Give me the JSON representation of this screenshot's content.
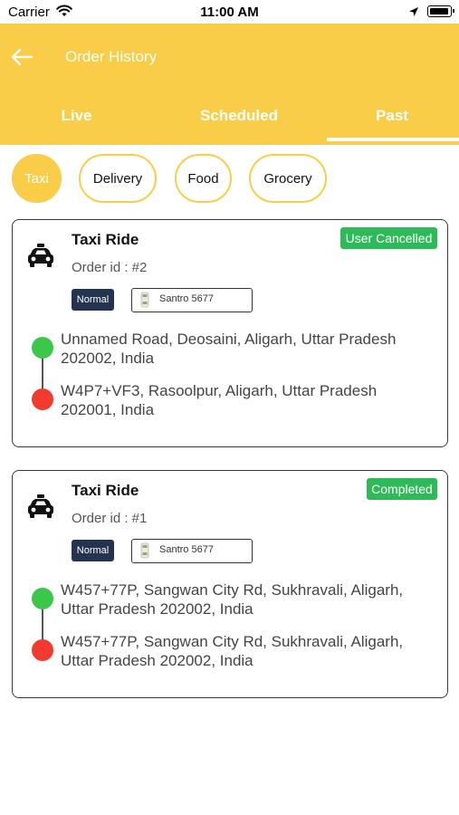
{
  "status_bar": {
    "carrier": "Carrier",
    "time": "11:00 AM"
  },
  "header": {
    "title": "Order History",
    "tabs": [
      {
        "label": "Live"
      },
      {
        "label": "Scheduled"
      },
      {
        "label": "Past",
        "active": true
      }
    ]
  },
  "filters": [
    {
      "label": "Taxi",
      "active": true
    },
    {
      "label": "Delivery"
    },
    {
      "label": "Food"
    },
    {
      "label": "Grocery"
    }
  ],
  "orders": [
    {
      "title": "Taxi Ride",
      "order_id": "Order id : #2",
      "status": "User Cancelled",
      "type_tag": "Normal",
      "vehicle": "Santro 5677",
      "pickup": "Unnamed Road, Deosaini, Aligarh, Uttar Pradesh 202002, India",
      "drop": "W4P7+VF3, Rasoolpur, Aligarh, Uttar Pradesh 202001, India"
    },
    {
      "title": "Taxi Ride",
      "order_id": "Order id : #1",
      "status": "Completed",
      "type_tag": "Normal",
      "vehicle": "Santro 5677",
      "pickup": "W457+77P, Sangwan City Rd, Sukhravali, Aligarh, Uttar Pradesh 202002, India",
      "drop": "W457+77P, Sangwan City Rd, Sukhravali, Aligarh, Uttar Pradesh 202002, India"
    }
  ],
  "colors": {
    "brand_yellow": "#f9cd48",
    "status_green": "#2fba5a",
    "tag_navy": "#24334f",
    "pickup_green": "#3cc64a",
    "drop_red": "#f23b2e"
  },
  "icons": [
    "wifi-icon",
    "location-arrow-icon",
    "battery-icon",
    "back-arrow-icon",
    "taxi-icon",
    "car-thumbnail-icon"
  ]
}
